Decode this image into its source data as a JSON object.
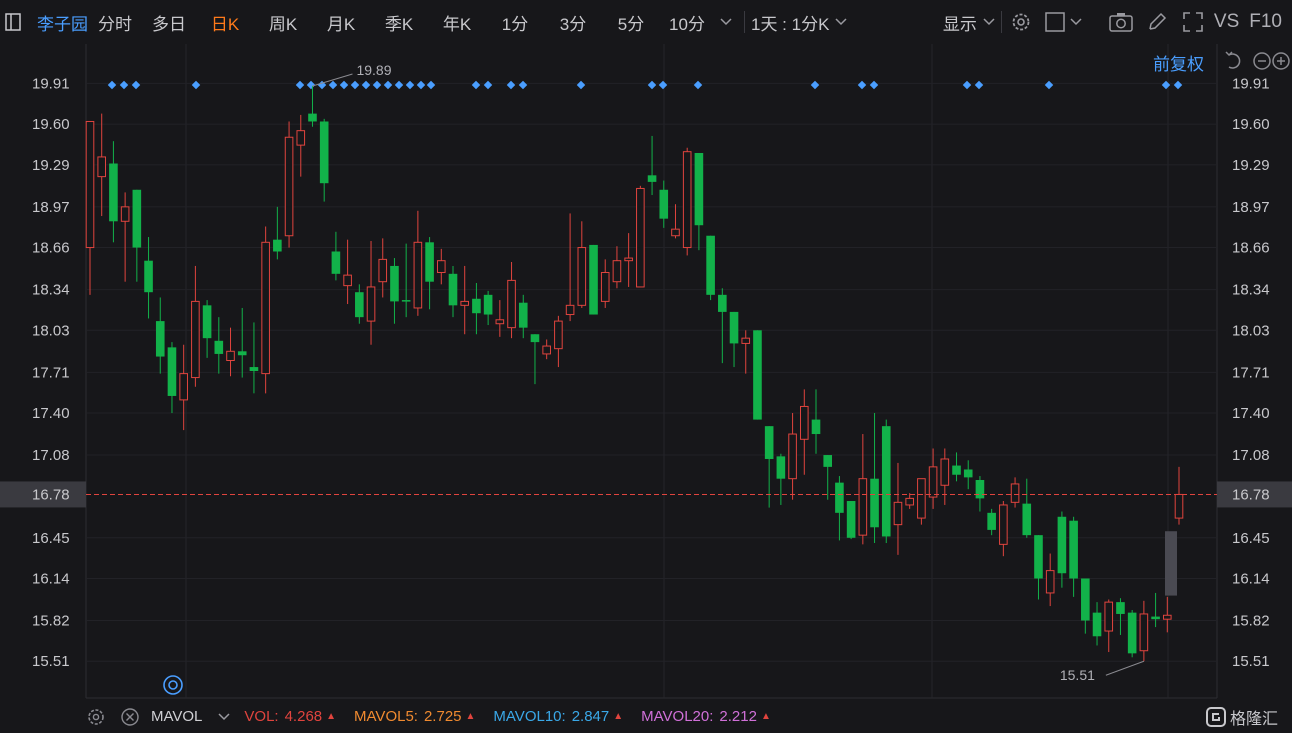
{
  "toolbar": {
    "stock_name": "李子园",
    "periods": [
      "分时",
      "多日",
      "日K",
      "周K",
      "月K",
      "季K",
      "年K",
      "1分",
      "3分",
      "5分",
      "10分"
    ],
    "active_period": "日K",
    "combo": "1天 : 1分K",
    "display_label": "显示",
    "vs_label": "VS",
    "f10_label": "F10",
    "fq_label": "前复权"
  },
  "colors": {
    "up": "#e0443e",
    "down": "#12b24a",
    "accent_active": "#ff7a1a",
    "link": "#4a9eff",
    "price_line": "#e0443e"
  },
  "bottom": {
    "indicator": "MAVOL",
    "vol_label": "VOL:",
    "vol_value": "4.268",
    "mavol5_label": "MAVOL5:",
    "mavol5_value": "2.725",
    "mavol10_label": "MAVOL10:",
    "mavol10_value": "2.847",
    "mavol20_label": "MAVOL20:",
    "mavol20_value": "2.212",
    "brand": "格隆汇"
  },
  "chart_data": {
    "type": "candlestick",
    "y_ticks": [
      "19.91",
      "19.60",
      "19.29",
      "18.97",
      "18.66",
      "18.34",
      "18.03",
      "17.71",
      "17.40",
      "17.08",
      "16.78",
      "16.45",
      "16.14",
      "15.82",
      "15.51"
    ],
    "ylim": [
      15.23,
      20.21
    ],
    "current_price": "16.78",
    "high_label": "19.89",
    "low_label": "15.51",
    "candles": [
      {
        "o": 18.66,
        "c": 19.62,
        "h": 19.62,
        "l": 18.3
      },
      {
        "o": 19.2,
        "c": 19.35,
        "h": 19.68,
        "l": 18.9
      },
      {
        "o": 19.3,
        "c": 18.86,
        "h": 19.47,
        "l": 18.7
      },
      {
        "o": 18.86,
        "c": 18.97,
        "h": 19.08,
        "l": 18.4
      },
      {
        "o": 19.1,
        "c": 18.66,
        "h": 19.1,
        "l": 18.4
      },
      {
        "o": 18.56,
        "c": 18.32,
        "h": 18.74,
        "l": 18.12
      },
      {
        "o": 18.1,
        "c": 17.83,
        "h": 18.28,
        "l": 17.7
      },
      {
        "o": 17.9,
        "c": 17.53,
        "h": 17.94,
        "l": 17.4
      },
      {
        "o": 17.5,
        "c": 17.7,
        "h": 17.92,
        "l": 17.27
      },
      {
        "o": 17.67,
        "c": 18.25,
        "h": 18.52,
        "l": 17.6
      },
      {
        "o": 18.22,
        "c": 17.97,
        "h": 18.26,
        "l": 17.82
      },
      {
        "o": 17.95,
        "c": 17.85,
        "h": 18.13,
        "l": 17.7
      },
      {
        "o": 17.8,
        "c": 17.87,
        "h": 18.05,
        "l": 17.68
      },
      {
        "o": 17.87,
        "c": 17.84,
        "h": 18.2,
        "l": 17.67
      },
      {
        "o": 17.75,
        "c": 17.72,
        "h": 18.09,
        "l": 17.55
      },
      {
        "o": 17.7,
        "c": 18.7,
        "h": 18.82,
        "l": 17.55
      },
      {
        "o": 18.72,
        "c": 18.63,
        "h": 18.97,
        "l": 18.57
      },
      {
        "o": 18.75,
        "c": 19.5,
        "h": 19.62,
        "l": 18.66
      },
      {
        "o": 19.44,
        "c": 19.55,
        "h": 19.67,
        "l": 19.2
      },
      {
        "o": 19.68,
        "c": 19.62,
        "h": 19.89,
        "l": 19.58
      },
      {
        "o": 19.62,
        "c": 19.15,
        "h": 19.64,
        "l": 19.01
      },
      {
        "o": 18.63,
        "c": 18.46,
        "h": 18.78,
        "l": 18.41
      },
      {
        "o": 18.37,
        "c": 18.45,
        "h": 18.72,
        "l": 18.23
      },
      {
        "o": 18.32,
        "c": 18.13,
        "h": 18.38,
        "l": 18.08
      },
      {
        "o": 18.1,
        "c": 18.36,
        "h": 18.71,
        "l": 17.92
      },
      {
        "o": 18.4,
        "c": 18.57,
        "h": 18.73,
        "l": 18.28
      },
      {
        "o": 18.52,
        "c": 18.25,
        "h": 18.58,
        "l": 18.08
      },
      {
        "o": 18.26,
        "c": 18.25,
        "h": 18.69,
        "l": 18.13
      },
      {
        "o": 18.2,
        "c": 18.7,
        "h": 18.94,
        "l": 18.14
      },
      {
        "o": 18.7,
        "c": 18.4,
        "h": 18.74,
        "l": 18.19
      },
      {
        "o": 18.47,
        "c": 18.56,
        "h": 18.65,
        "l": 18.38
      },
      {
        "o": 18.46,
        "c": 18.22,
        "h": 18.52,
        "l": 18.13
      },
      {
        "o": 18.22,
        "c": 18.25,
        "h": 18.52,
        "l": 18.0
      },
      {
        "o": 18.27,
        "c": 18.16,
        "h": 18.39,
        "l": 18.0
      },
      {
        "o": 18.3,
        "c": 18.15,
        "h": 18.33,
        "l": 18.07
      },
      {
        "o": 18.08,
        "c": 18.11,
        "h": 18.26,
        "l": 17.98
      },
      {
        "o": 18.05,
        "c": 18.41,
        "h": 18.55,
        "l": 17.97
      },
      {
        "o": 18.24,
        "c": 18.05,
        "h": 18.3,
        "l": 17.97
      },
      {
        "o": 18.0,
        "c": 17.94,
        "h": 18.0,
        "l": 17.62
      },
      {
        "o": 17.85,
        "c": 17.91,
        "h": 17.96,
        "l": 17.81
      },
      {
        "o": 17.89,
        "c": 18.1,
        "h": 18.14,
        "l": 17.75
      },
      {
        "o": 18.15,
        "c": 18.22,
        "h": 18.92,
        "l": 18.1
      },
      {
        "o": 18.22,
        "c": 18.66,
        "h": 18.86,
        "l": 18.2
      },
      {
        "o": 18.68,
        "c": 18.15,
        "h": 18.68,
        "l": 18.15
      },
      {
        "o": 18.25,
        "c": 18.47,
        "h": 18.57,
        "l": 18.2
      },
      {
        "o": 18.4,
        "c": 18.56,
        "h": 18.67,
        "l": 18.35
      },
      {
        "o": 18.56,
        "c": 18.58,
        "h": 18.77,
        "l": 18.36
      },
      {
        "o": 18.36,
        "c": 19.11,
        "h": 19.13,
        "l": 18.36
      },
      {
        "o": 19.21,
        "c": 19.16,
        "h": 19.51,
        "l": 19.06
      },
      {
        "o": 19.1,
        "c": 18.88,
        "h": 19.17,
        "l": 18.81
      },
      {
        "o": 18.75,
        "c": 18.8,
        "h": 18.99,
        "l": 18.73
      },
      {
        "o": 18.66,
        "c": 19.39,
        "h": 19.42,
        "l": 18.6
      },
      {
        "o": 19.38,
        "c": 18.83,
        "h": 19.38,
        "l": 18.64
      },
      {
        "o": 18.75,
        "c": 18.3,
        "h": 18.75,
        "l": 18.26
      },
      {
        "o": 18.3,
        "c": 18.17,
        "h": 18.35,
        "l": 17.78
      },
      {
        "o": 18.17,
        "c": 17.93,
        "h": 18.17,
        "l": 17.75
      },
      {
        "o": 17.93,
        "c": 17.97,
        "h": 18.03,
        "l": 17.7
      },
      {
        "o": 18.03,
        "c": 17.35,
        "h": 18.03,
        "l": 17.35
      },
      {
        "o": 17.3,
        "c": 17.05,
        "h": 17.3,
        "l": 16.68
      },
      {
        "o": 17.07,
        "c": 16.9,
        "h": 17.09,
        "l": 16.7
      },
      {
        "o": 16.9,
        "c": 17.24,
        "h": 17.4,
        "l": 16.74
      },
      {
        "o": 17.2,
        "c": 17.45,
        "h": 17.58,
        "l": 16.93
      },
      {
        "o": 17.35,
        "c": 17.24,
        "h": 17.58,
        "l": 17.09
      },
      {
        "o": 17.08,
        "c": 16.99,
        "h": 17.08,
        "l": 16.74
      },
      {
        "o": 16.87,
        "c": 16.64,
        "h": 16.92,
        "l": 16.43
      },
      {
        "o": 16.73,
        "c": 16.45,
        "h": 16.73,
        "l": 16.44
      },
      {
        "o": 16.47,
        "c": 16.9,
        "h": 17.24,
        "l": 16.4
      },
      {
        "o": 16.9,
        "c": 16.53,
        "h": 17.4,
        "l": 16.41
      },
      {
        "o": 17.3,
        "c": 16.46,
        "h": 17.35,
        "l": 16.41
      },
      {
        "o": 16.55,
        "c": 16.72,
        "h": 17.02,
        "l": 16.32
      },
      {
        "o": 16.7,
        "c": 16.75,
        "h": 16.79,
        "l": 16.67
      },
      {
        "o": 16.6,
        "c": 16.9,
        "h": 16.9,
        "l": 16.55
      },
      {
        "o": 16.76,
        "c": 16.99,
        "h": 17.13,
        "l": 16.67
      },
      {
        "o": 16.85,
        "c": 17.05,
        "h": 17.13,
        "l": 16.7
      },
      {
        "o": 17.0,
        "c": 16.93,
        "h": 17.1,
        "l": 16.88
      },
      {
        "o": 16.97,
        "c": 16.91,
        "h": 17.04,
        "l": 16.82
      },
      {
        "o": 16.89,
        "c": 16.75,
        "h": 16.92,
        "l": 16.65
      },
      {
        "o": 16.64,
        "c": 16.51,
        "h": 16.67,
        "l": 16.47
      },
      {
        "o": 16.4,
        "c": 16.7,
        "h": 16.73,
        "l": 16.31
      },
      {
        "o": 16.72,
        "c": 16.86,
        "h": 16.91,
        "l": 16.68
      },
      {
        "o": 16.71,
        "c": 16.47,
        "h": 16.9,
        "l": 16.45
      },
      {
        "o": 16.47,
        "c": 16.14,
        "h": 16.47,
        "l": 15.98
      },
      {
        "o": 16.03,
        "c": 16.2,
        "h": 16.33,
        "l": 15.93
      },
      {
        "o": 16.61,
        "c": 16.18,
        "h": 16.65,
        "l": 16.07
      },
      {
        "o": 16.58,
        "c": 16.14,
        "h": 16.61,
        "l": 16.0
      },
      {
        "o": 16.14,
        "c": 15.82,
        "h": 16.14,
        "l": 15.72
      },
      {
        "o": 15.88,
        "c": 15.7,
        "h": 15.96,
        "l": 15.63
      },
      {
        "o": 15.74,
        "c": 15.96,
        "h": 15.98,
        "l": 15.58
      },
      {
        "o": 15.96,
        "c": 15.87,
        "h": 15.99,
        "l": 15.71
      },
      {
        "o": 15.88,
        "c": 15.57,
        "h": 15.9,
        "l": 15.54
      },
      {
        "o": 15.59,
        "c": 15.87,
        "h": 15.97,
        "l": 15.51
      },
      {
        "o": 15.85,
        "c": 15.83,
        "h": 16.03,
        "l": 15.77
      },
      {
        "o": 15.83,
        "c": 15.86,
        "h": 16.0,
        "l": 15.73
      },
      {
        "o": 16.6,
        "c": 16.78,
        "h": 16.99,
        "l": 16.55
      }
    ]
  }
}
